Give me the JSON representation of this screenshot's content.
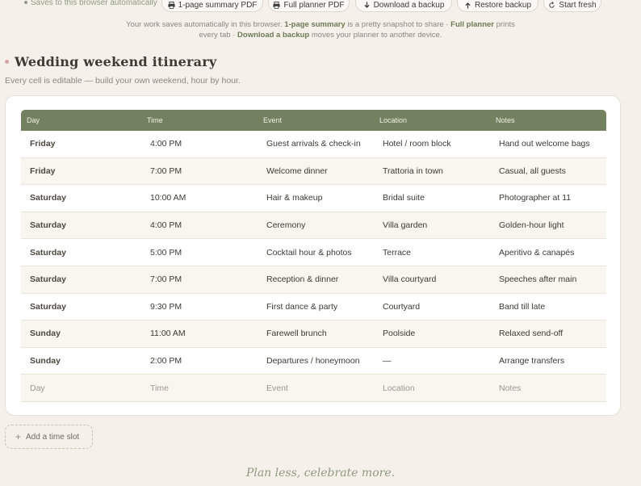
{
  "toolbar": {
    "save_status": "Saves to this browser automatically",
    "buttons": [
      {
        "label": "1-page summary PDF",
        "icon": "printer-icon"
      },
      {
        "label": "Full planner PDF",
        "icon": "printer-icon"
      },
      {
        "label": "Download a backup",
        "icon": "download-arrow-icon"
      },
      {
        "label": "Restore backup",
        "icon": "upload-arrow-icon"
      },
      {
        "label": "Start fresh",
        "icon": "refresh-icon"
      }
    ]
  },
  "help": {
    "line1_a": "Your work saves automatically in this browser.",
    "line1_b": "1-page summary",
    "line1_c": "is a pretty snapshot to share ·",
    "line1_d": "Full planner",
    "line1_e": "prints",
    "line2_a": "every tab ·",
    "line2_b": "Download a backup",
    "line2_c": "moves your planner to another device."
  },
  "section": {
    "title": "Wedding weekend itinerary",
    "subtitle": "Every cell is editable — build your own weekend, hour by hour."
  },
  "table": {
    "headers": [
      "Day",
      "Time",
      "Event",
      "Location",
      "Notes"
    ],
    "rows": [
      [
        "Friday",
        "4:00 PM",
        "Guest arrivals & check-in",
        "Hotel / room block",
        "Hand out welcome bags"
      ],
      [
        "Friday",
        "7:00 PM",
        "Welcome dinner",
        "Trattoria in town",
        "Casual, all guests"
      ],
      [
        "Saturday",
        "10:00 AM",
        "Hair & makeup",
        "Bridal suite",
        "Photographer at 11"
      ],
      [
        "Saturday",
        "4:00 PM",
        "Ceremony",
        "Villa garden",
        "Golden-hour light"
      ],
      [
        "Saturday",
        "5:00 PM",
        "Cocktail hour & photos",
        "Terrace",
        "Aperitivo & canapés"
      ],
      [
        "Saturday",
        "7:00 PM",
        "Reception & dinner",
        "Villa courtyard",
        "Speeches after main"
      ],
      [
        "Saturday",
        "9:30 PM",
        "First dance & party",
        "Courtyard",
        "Band till late"
      ],
      [
        "Sunday",
        "11:00 AM",
        "Farewell brunch",
        "Poolside",
        "Relaxed send-off"
      ],
      [
        "Sunday",
        "2:00 PM",
        "Departures / honeymoon",
        "—",
        "Arrange transfers"
      ]
    ],
    "placeholders": [
      "Day",
      "Time",
      "Event",
      "Location",
      "Notes"
    ]
  },
  "add_slot_label": "Add a time slot",
  "footer": "Plan less, celebrate more.",
  "colors": {
    "header_bg": "#738160",
    "accent": "#6b7a55",
    "page_bg": "#f5f1ea",
    "bullet": "#d3a6a4"
  }
}
